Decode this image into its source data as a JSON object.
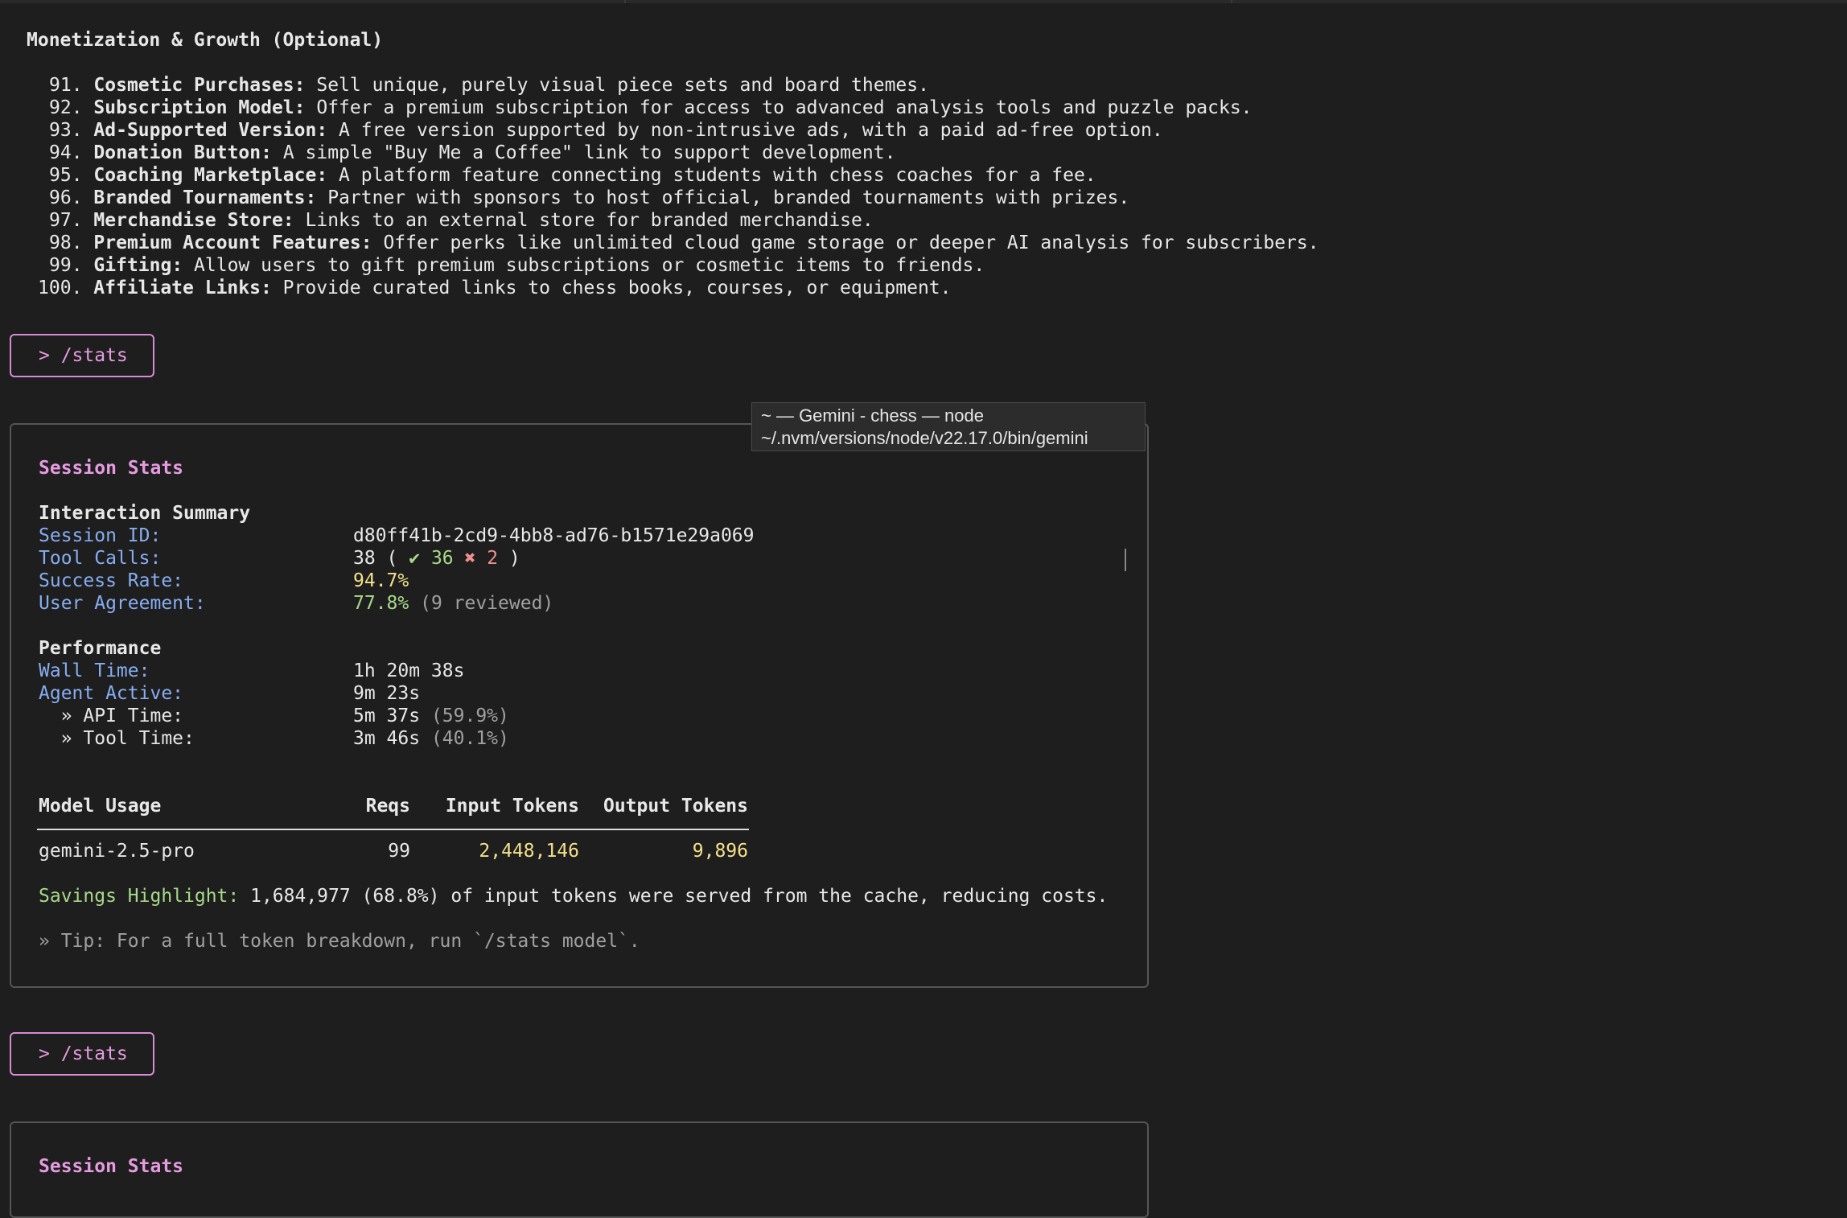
{
  "heading": "Monetization & Growth (Optional)",
  "list": [
    {
      "num": "91.",
      "title": "Cosmetic Purchases:",
      "text": " Sell unique, purely visual piece sets and board themes."
    },
    {
      "num": "92.",
      "title": "Subscription Model:",
      "text": " Offer a premium subscription for access to advanced analysis tools and puzzle packs."
    },
    {
      "num": "93.",
      "title": "Ad-Supported Version:",
      "text": " A free version supported by non-intrusive ads, with a paid ad-free option."
    },
    {
      "num": "94.",
      "title": "Donation Button:",
      "text": " A simple \"Buy Me a Coffee\" link to support development."
    },
    {
      "num": "95.",
      "title": "Coaching Marketplace:",
      "text": " A platform feature connecting students with chess coaches for a fee."
    },
    {
      "num": "96.",
      "title": "Branded Tournaments:",
      "text": " Partner with sponsors to host official, branded tournaments with prizes."
    },
    {
      "num": "97.",
      "title": "Merchandise Store:",
      "text": " Links to an external store for branded merchandise."
    },
    {
      "num": "98.",
      "title": "Premium Account Features:",
      "text": " Offer perks like unlimited cloud game storage or deeper AI analysis for subscribers."
    },
    {
      "num": "99.",
      "title": "Gifting:",
      "text": " Allow users to gift premium subscriptions or cosmetic items to friends."
    },
    {
      "num": "100.",
      "title": "Affiliate Links:",
      "text": " Provide curated links to chess books, courses, or equipment."
    }
  ],
  "command1": "> /stats",
  "command2": "> /stats",
  "tooltip": "~ — Gemini - chess — node ~/.nvm/versions/node/v22.17.0/bin/gemini",
  "stats": {
    "title": "Session Stats",
    "interaction_heading": "Interaction Summary",
    "session_id_label": "Session ID:",
    "session_id": "d80ff41b-2cd9-4bb8-ad76-b1571e29a069",
    "tool_calls_label": "Tool Calls:",
    "tool_calls_total": "38 ( ",
    "tool_calls_ok": "✔ 36",
    "tool_calls_fail": "✖ 2",
    "tool_calls_close": " )",
    "success_rate_label": "Success Rate:",
    "success_rate": "94.7%",
    "user_agreement_label": "User Agreement:",
    "user_agreement": "77.8%",
    "user_agreement_note": " (9 reviewed)",
    "performance_heading": "Performance",
    "wall_time_label": "Wall Time:",
    "wall_time": "1h 20m 38s",
    "agent_active_label": "Agent Active:",
    "agent_active": "9m 23s",
    "api_time_label": "  » API Time:",
    "api_time": "5m 37s",
    "api_time_pct": " (59.9%)",
    "tool_time_label": "  » Tool Time:",
    "tool_time": "3m 46s",
    "tool_time_pct": " (40.1%)",
    "table_headers": {
      "model": "Model Usage",
      "reqs": "Reqs",
      "input": "Input Tokens",
      "output": "Output Tokens"
    },
    "table_rows": [
      {
        "model": "gemini-2.5-pro",
        "reqs": "99",
        "input": "2,448,146",
        "output": "9,896"
      }
    ],
    "savings_label": "Savings Highlight:",
    "savings_text": " 1,684,977 (68.8%) of input tokens were served from the cache, reducing costs.",
    "tip": "» Tip: For a full token breakdown, run `/stats model`."
  },
  "stats2_title": "Session Stats"
}
